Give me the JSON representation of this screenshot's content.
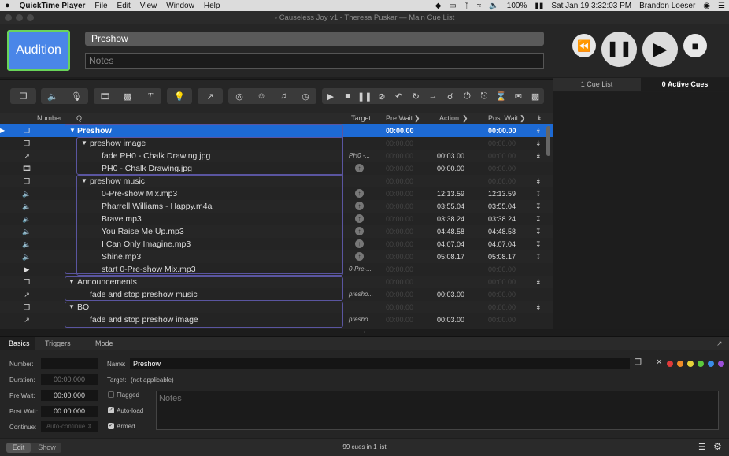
{
  "menubar": {
    "apple": "",
    "app_name": "QuickTime Player",
    "items": [
      "File",
      "Edit",
      "View",
      "Window",
      "Help"
    ],
    "battery": "100%",
    "datetime": "Sat Jan 19  3:32:03 PM",
    "user": "Brandon Loeser"
  },
  "window": {
    "title": "Causeless Joy v1 - Theresa Puskar — Main Cue List"
  },
  "header": {
    "audition_label": "Audition",
    "name_value": "Preshow",
    "notes_placeholder": "Notes"
  },
  "transport": {
    "rewind_icon": "rewind-icon",
    "pause_icon": "pause-icon",
    "play_icon": "play-icon",
    "stop_icon": "stop-icon"
  },
  "right_tabs": {
    "cue_lists": "1 Cue List",
    "active_cues": "0 Active Cues"
  },
  "columns": {
    "number": "Number",
    "q": "Q",
    "target": "Target",
    "pre_wait": "Pre Wait",
    "action": "Action",
    "post_wait": "Post Wait"
  },
  "cues": [
    {
      "q": "Preshow",
      "target": "",
      "pre": "00:00.00",
      "action": "",
      "post": "00:00.00"
    },
    {
      "q": "preshow image",
      "target": "",
      "pre": "00:00.00",
      "action": "",
      "post": "00:00.00"
    },
    {
      "q": "fade PH0 - Chalk Drawing.jpg",
      "target": "PH0 -...",
      "pre": "00:00.00",
      "action": "00:03.00",
      "post": "00:00.00"
    },
    {
      "q": "PH0 - Chalk Drawing.jpg",
      "target": "",
      "pre": "00:00.00",
      "action": "00:00.00",
      "post": "00:00.00"
    },
    {
      "q": "preshow music",
      "target": "",
      "pre": "00:00.00",
      "action": "",
      "post": "00:00.00"
    },
    {
      "q": "0-Pre-show Mix.mp3",
      "target": "",
      "pre": "00:00.00",
      "action": "12:13.59",
      "post": "12:13.59"
    },
    {
      "q": "Pharrell Williams - Happy.m4a",
      "target": "",
      "pre": "00:00.00",
      "action": "03:55.04",
      "post": "03:55.04"
    },
    {
      "q": "Brave.mp3",
      "target": "",
      "pre": "00:00.00",
      "action": "03:38.24",
      "post": "03:38.24"
    },
    {
      "q": "You Raise Me Up.mp3",
      "target": "",
      "pre": "00:00.00",
      "action": "04:48.58",
      "post": "04:48.58"
    },
    {
      "q": "I Can Only Imagine.mp3",
      "target": "",
      "pre": "00:00.00",
      "action": "04:07.04",
      "post": "04:07.04"
    },
    {
      "q": "Shine.mp3",
      "target": "",
      "pre": "00:00.00",
      "action": "05:08.17",
      "post": "05:08.17"
    },
    {
      "q": "start 0-Pre-show Mix.mp3",
      "target": "0-Pre-...",
      "pre": "00:00.00",
      "action": "",
      "post": "00:00.00"
    },
    {
      "q": "Announcements",
      "target": "",
      "pre": "00:00.00",
      "action": "",
      "post": "00:00.00"
    },
    {
      "q": "fade and stop preshow music",
      "target": "presho...",
      "pre": "00:00.00",
      "action": "00:03.00",
      "post": "00:00.00"
    },
    {
      "q": "BO",
      "target": "",
      "pre": "00:00.00",
      "action": "",
      "post": "00:00.00"
    },
    {
      "q": "fade and stop preshow image",
      "target": "presho...",
      "pre": "00:00.00",
      "action": "00:03.00",
      "post": "00:00.00"
    }
  ],
  "inspector": {
    "tabs": [
      "Basics",
      "Triggers",
      "Mode"
    ],
    "number_label": "Number:",
    "duration_label": "Duration:",
    "duration_value": "00:00.000",
    "prewait_label": "Pre Wait:",
    "prewait_value": "00:00.000",
    "postwait_label": "Post Wait:",
    "postwait_value": "00:00.000",
    "continue_label": "Continue:",
    "continue_value": "Auto-continue",
    "name_label": "Name:",
    "name_value": "Preshow",
    "target_label": "Target:",
    "target_value": "(not applicable)",
    "flagged_label": "Flagged",
    "autoload_label": "Auto-load",
    "armed_label": "Armed",
    "notes_placeholder": "Notes",
    "colors": [
      "#e03a3a",
      "#f08c28",
      "#e8d23a",
      "#5cc83c",
      "#3a8ce8",
      "#9b4fd8"
    ]
  },
  "footer": {
    "edit": "Edit",
    "show": "Show",
    "status": "99 cues in 1 list"
  }
}
